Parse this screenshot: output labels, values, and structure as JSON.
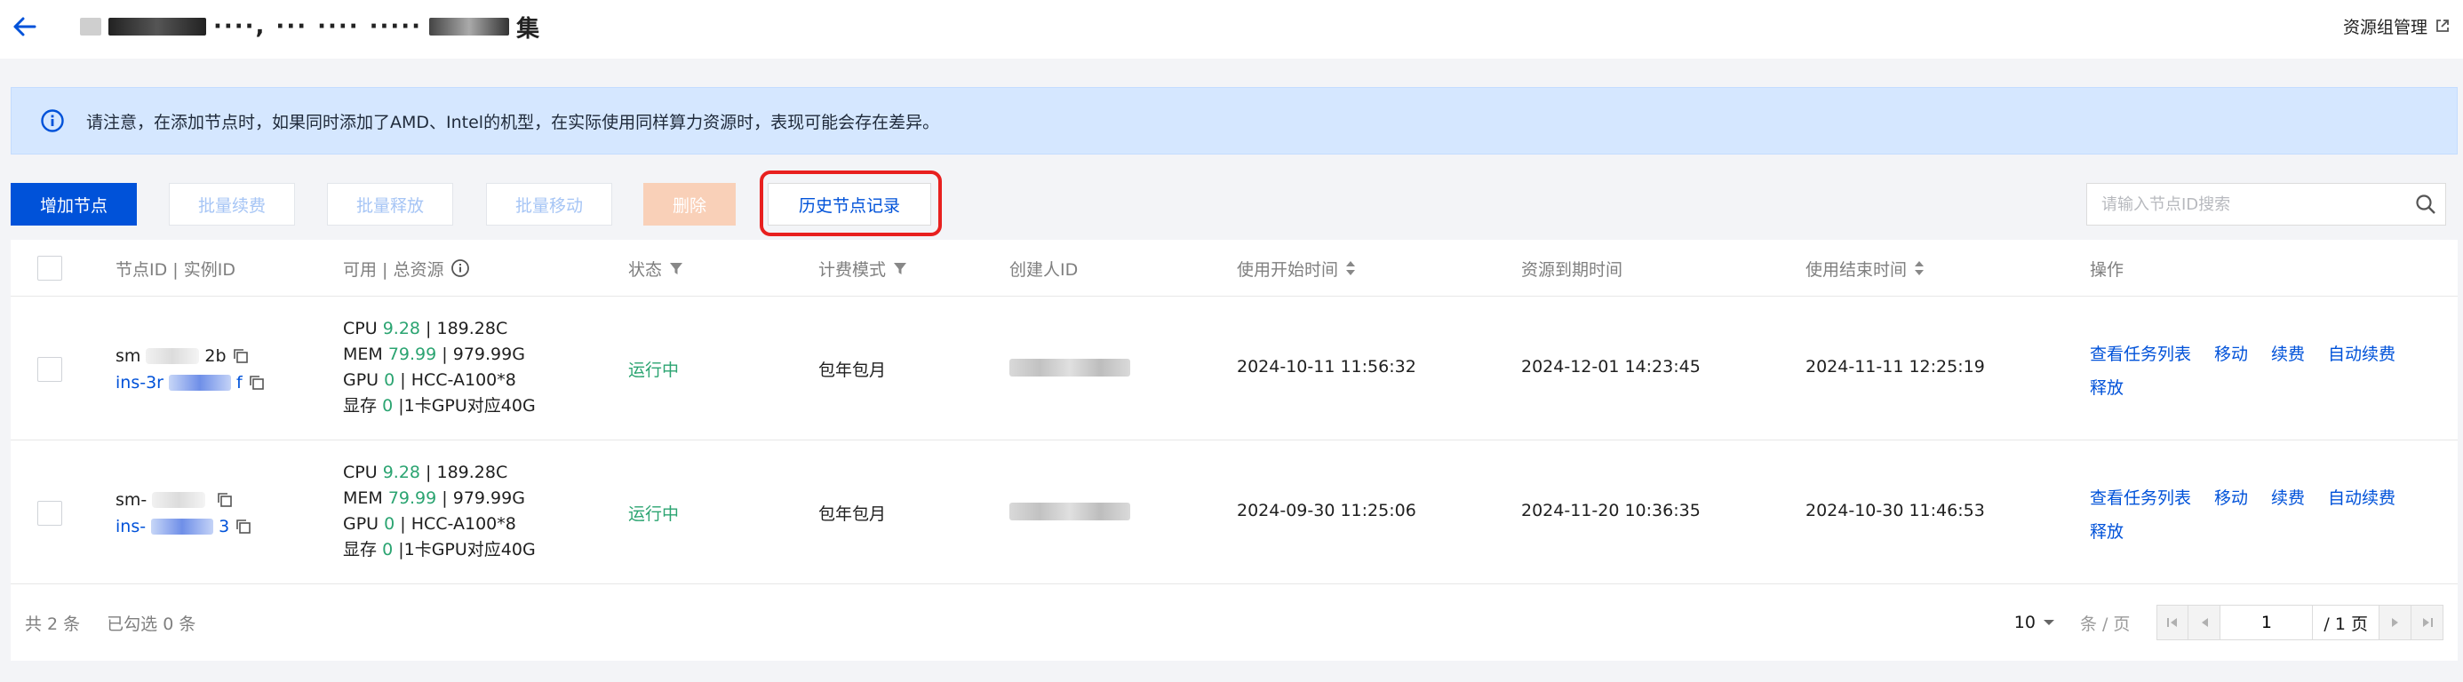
{
  "header": {
    "title_redacted": "····, ··· ···· ·····",
    "title_suffix": "集",
    "resource_group_link": "资源组管理"
  },
  "notice": {
    "text": "请注意，在添加节点时，如果同时添加了AMD、Intel的机型，在实际使用同样算力资源时，表现可能会存在差异。"
  },
  "toolbar": {
    "add_node": "增加节点",
    "batch_renew": "批量续费",
    "batch_release": "批量释放",
    "batch_move": "批量移动",
    "delete": "删除",
    "history": "历史节点记录",
    "search_placeholder": "请输入节点ID搜索"
  },
  "table": {
    "columns": {
      "node_id": "节点ID | 实例ID",
      "resources": "可用 | 总资源",
      "status": "状态",
      "billing": "计费模式",
      "creator": "创建人ID",
      "start": "使用开始时间",
      "expire": "资源到期时间",
      "end": "使用结束时间",
      "actions": "操作"
    },
    "rows": [
      {
        "node_prefix": "sm",
        "node_suffix": "2b",
        "inst_prefix": "ins-3r",
        "inst_suffix": "f",
        "cpu_label": "CPU",
        "cpu_avail": "9.28",
        "cpu_total": "| 189.28C",
        "mem_label": "MEM",
        "mem_avail": "79.99",
        "mem_total": "| 979.99G",
        "gpu_label": "GPU",
        "gpu_avail": "0",
        "gpu_total": "| HCC-A100*8",
        "vram_label": "显存",
        "vram_avail": "0",
        "vram_total": "|1卡GPU对应40G",
        "status": "运行中",
        "billing": "包年包月",
        "start": "2024-10-11 11:56:32",
        "expire": "2024-12-01 14:23:45",
        "end": "2024-11-11 12:25:19"
      },
      {
        "node_prefix": "sm-",
        "node_suffix": "",
        "inst_prefix": "ins-",
        "inst_suffix": "3",
        "cpu_label": "CPU",
        "cpu_avail": "9.28",
        "cpu_total": "| 189.28C",
        "mem_label": "MEM",
        "mem_avail": "79.99",
        "mem_total": "| 979.99G",
        "gpu_label": "GPU",
        "gpu_avail": "0",
        "gpu_total": "| HCC-A100*8",
        "vram_label": "显存",
        "vram_avail": "0",
        "vram_total": "|1卡GPU对应40G",
        "status": "运行中",
        "billing": "包年包月",
        "start": "2024-09-30 11:25:06",
        "expire": "2024-11-20 10:36:35",
        "end": "2024-10-30 11:46:53"
      }
    ],
    "actions": {
      "view_tasks": "查看任务列表",
      "move": "移动",
      "renew": "续费",
      "auto_renew": "自动续费",
      "release": "释放"
    }
  },
  "footer": {
    "total": "共 2 条",
    "selected": "已勾选 0 条",
    "page_size": "10",
    "per_page_label": "条 / 页",
    "current_page": "1",
    "total_pages": "/ 1 页"
  },
  "colors": {
    "primary": "#0052d9",
    "success": "#2ba471",
    "notice_bg": "#d5e7ff",
    "danger_disabled": "#f9d0b8",
    "highlight": "#e8201f"
  }
}
